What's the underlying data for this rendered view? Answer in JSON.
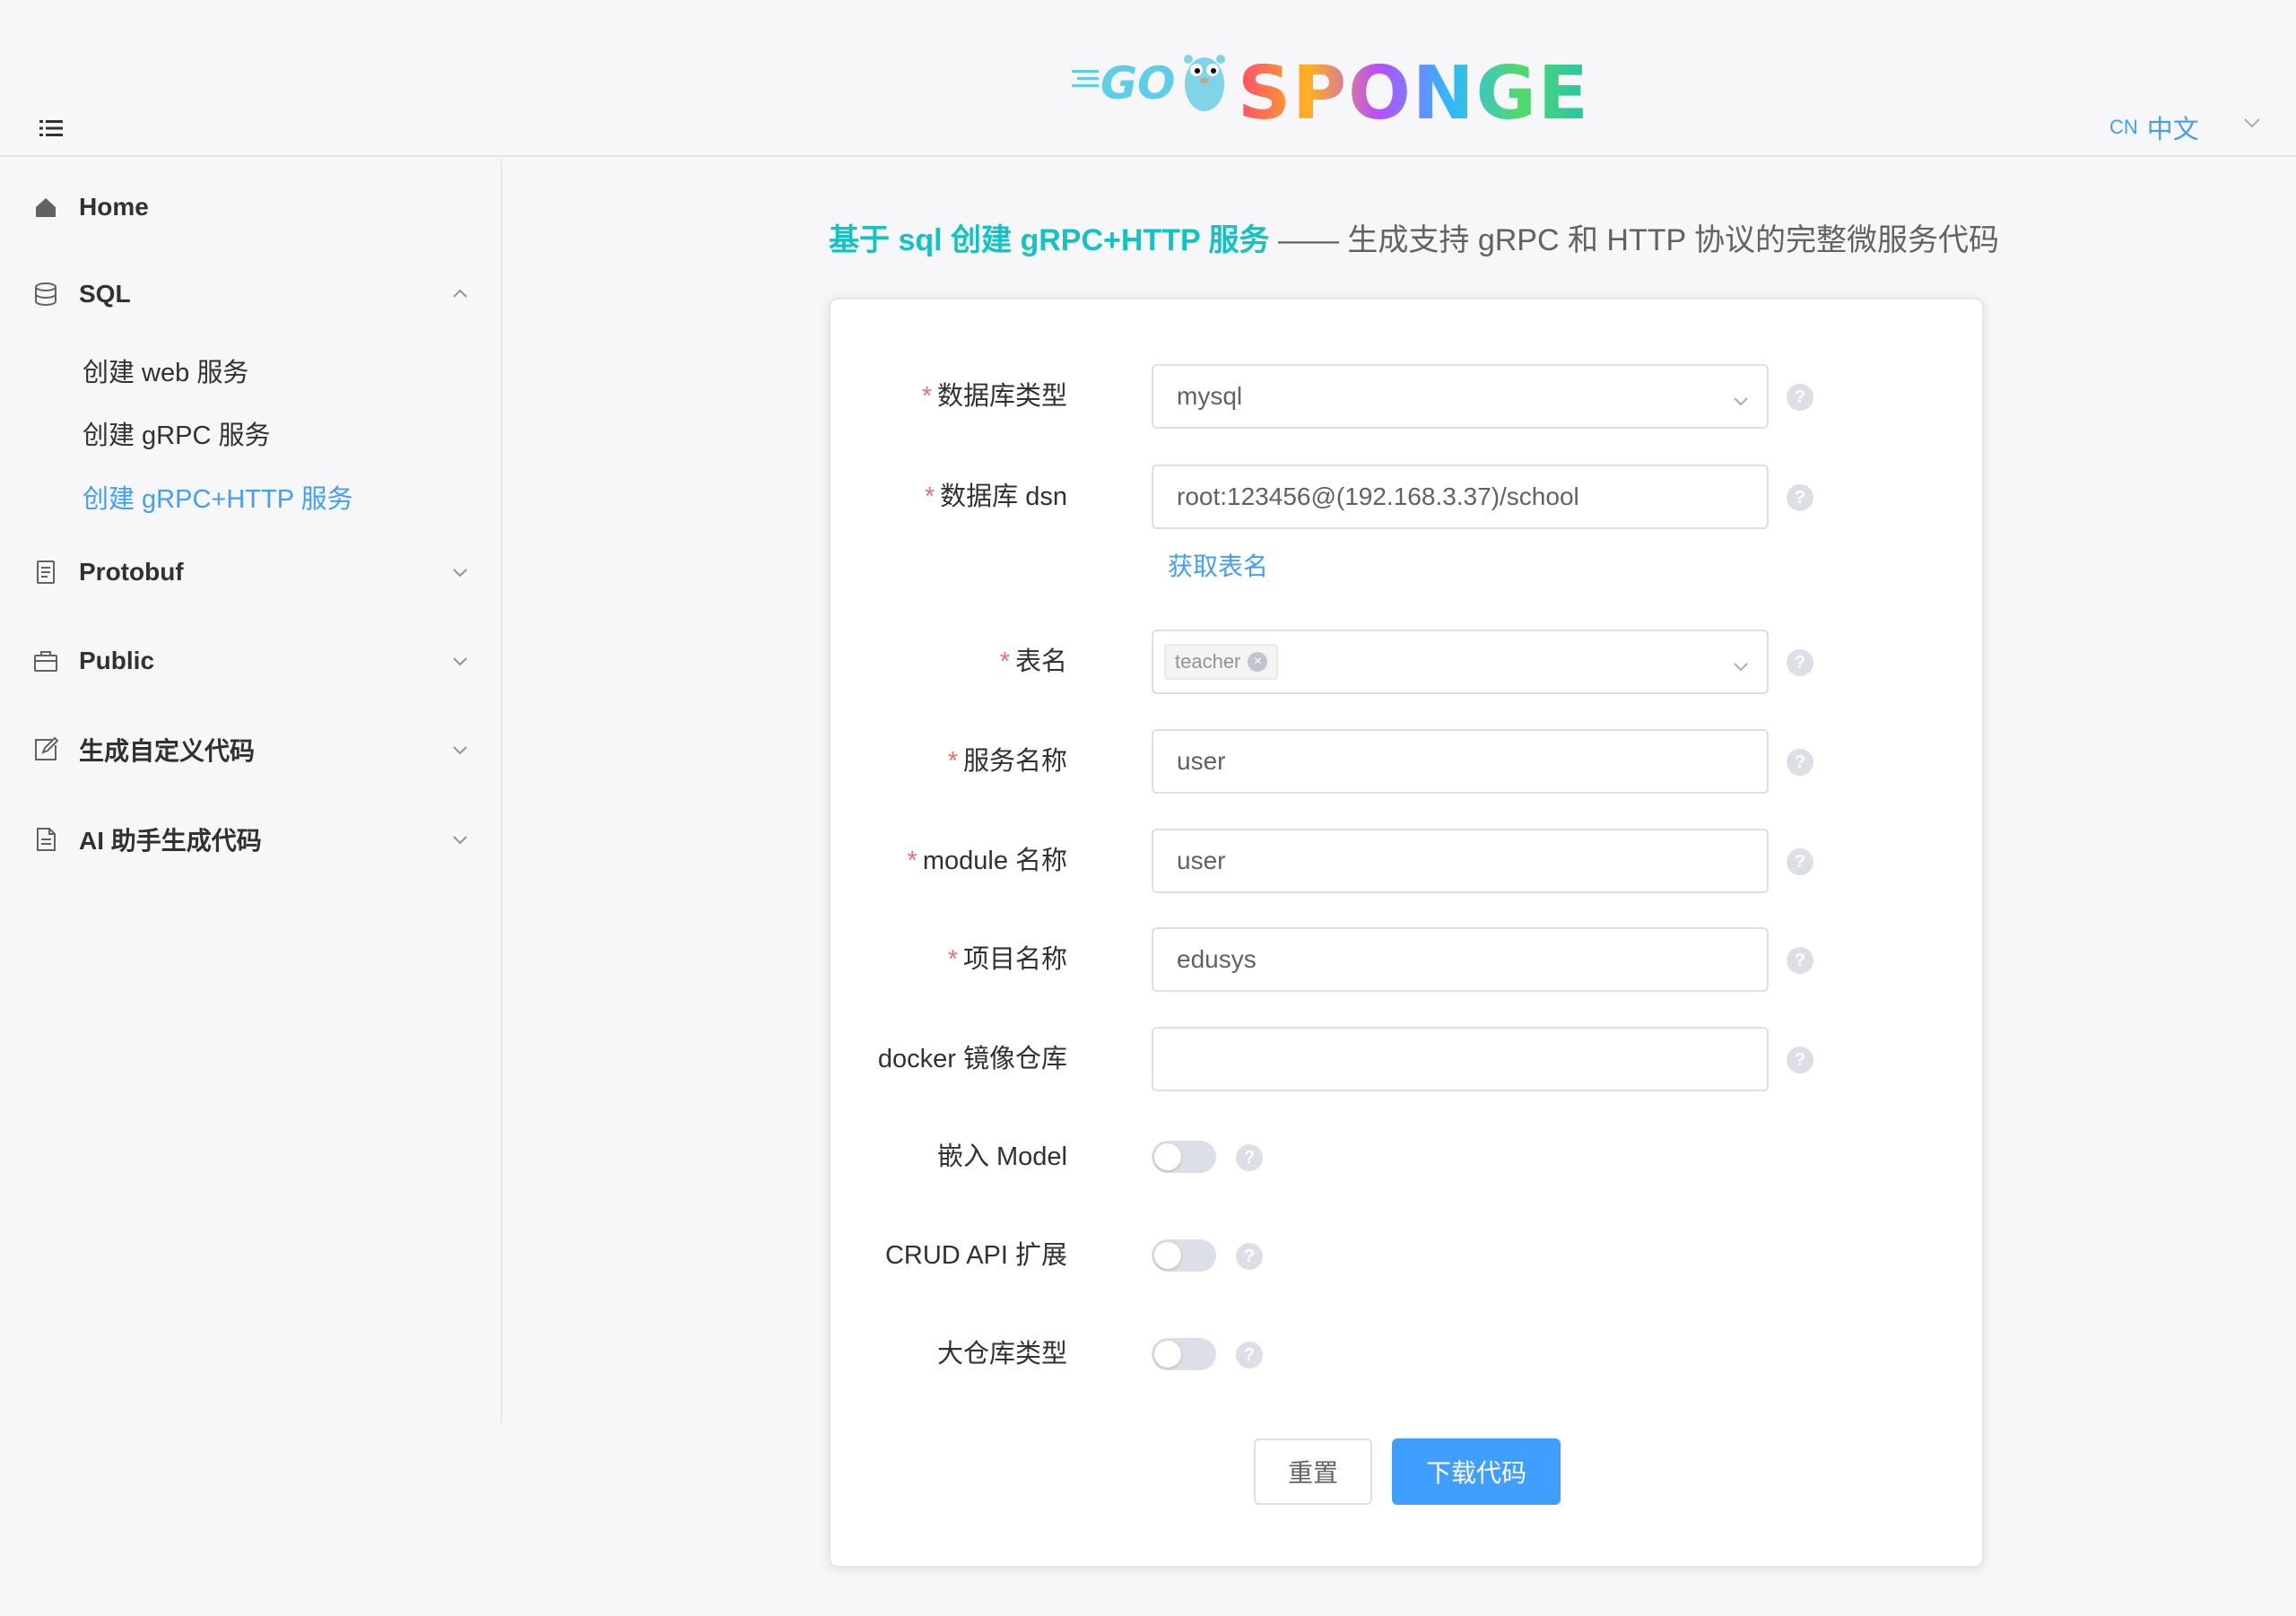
{
  "header": {
    "logo_go": "GO",
    "logo_brand": "SPONGE",
    "lang_code": "CN",
    "lang_name": "中文"
  },
  "sidebar": {
    "items": [
      {
        "label": "Home",
        "icon": "home-icon"
      },
      {
        "label": "SQL",
        "icon": "database-icon",
        "expanded": true,
        "children": [
          "创建 web 服务",
          "创建 gRPC 服务",
          "创建 gRPC+HTTP 服务"
        ]
      },
      {
        "label": "Protobuf",
        "icon": "document-icon"
      },
      {
        "label": "Public",
        "icon": "briefcase-icon"
      },
      {
        "label": "生成自定义代码",
        "icon": "edit-icon"
      },
      {
        "label": "AI 助手生成代码",
        "icon": "file-text-icon"
      }
    ],
    "active_child": "创建 gRPC+HTTP 服务"
  },
  "main": {
    "title_highlight": "基于 sql 创建 gRPC+HTTP 服务",
    "title_rest": "—— 生成支持 gRPC 和 HTTP 协议的完整微服务代码",
    "form": {
      "db_type": {
        "label": "数据库类型",
        "value": "mysql"
      },
      "db_dsn": {
        "label": "数据库 dsn",
        "value": "root:123456@(192.168.3.37)/school"
      },
      "fetch_tables_link": "获取表名",
      "table_name": {
        "label": "表名",
        "tag": "teacher"
      },
      "service_name": {
        "label": "服务名称",
        "value": "user"
      },
      "module_name": {
        "label": "module 名称",
        "value": "user"
      },
      "project_name": {
        "label": "项目名称",
        "value": "edusys"
      },
      "docker_repo": {
        "label": "docker 镜像仓库",
        "value": ""
      },
      "embed_model": {
        "label": "嵌入 Model",
        "on": false
      },
      "crud_api_ext": {
        "label": "CRUD API 扩展",
        "on": false
      },
      "mono_repo": {
        "label": "大仓库类型",
        "on": false
      },
      "help_glyph": "?",
      "required_mark": "*"
    },
    "buttons": {
      "reset": "重置",
      "download": "下载代码"
    }
  },
  "colors": {
    "accent": "#409eff",
    "title_highlight": "#13c2c2",
    "required": "#f56c6c"
  }
}
